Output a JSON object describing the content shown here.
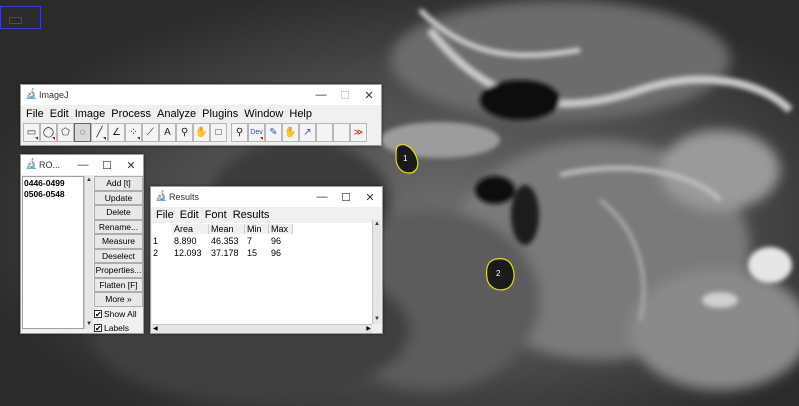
{
  "background": {
    "rois": [
      {
        "label": "1"
      },
      {
        "label": "2"
      }
    ],
    "roi_color": "#e6e000"
  },
  "imagej": {
    "title": "ImageJ",
    "menu": [
      "File",
      "Edit",
      "Image",
      "Process",
      "Analyze",
      "Plugins",
      "Window",
      "Help"
    ],
    "tools": [
      {
        "icon": "rectangle-tool-icon",
        "glyph": "▭"
      },
      {
        "icon": "oval-tool-icon",
        "glyph": "◯"
      },
      {
        "icon": "polygon-tool-icon",
        "glyph": "⬠"
      },
      {
        "icon": "freehand-tool-icon",
        "glyph": "◌"
      },
      {
        "icon": "line-tool-icon",
        "glyph": "╱"
      },
      {
        "icon": "angle-tool-icon",
        "glyph": "∠"
      },
      {
        "icon": "point-tool-icon",
        "glyph": "⁘"
      },
      {
        "icon": "wand-tool-icon",
        "glyph": "⟋"
      },
      {
        "icon": "text-tool-icon",
        "glyph": "A"
      },
      {
        "icon": "magnifying-glass-icon",
        "glyph": "🔍"
      },
      {
        "icon": "scrolling-tool-icon",
        "glyph": "✋"
      },
      {
        "icon": "color-picker-icon",
        "glyph": "□"
      },
      {
        "icon": "zoom-icon",
        "glyph": "Q"
      },
      {
        "icon": "developer-menu-icon",
        "glyph": "Dev"
      },
      {
        "icon": "pencil-tool-icon",
        "glyph": "✎"
      },
      {
        "icon": "hand-tool-icon",
        "glyph": "✋"
      },
      {
        "icon": "arrow-tool-icon",
        "glyph": "↗"
      },
      {
        "icon": "blank-tool-slot",
        "glyph": ""
      },
      {
        "icon": "blank-tool-slot",
        "glyph": ""
      },
      {
        "icon": "more-tools-icon",
        "glyph": "≫"
      }
    ]
  },
  "roi_manager": {
    "title": "RO...",
    "items": [
      "0446-0499",
      "0506-0548"
    ],
    "buttons": [
      "Add [t]",
      "Update",
      "Delete",
      "Rename...",
      "Measure",
      "Deselect",
      "Properties...",
      "Flatten [F]",
      "More »"
    ],
    "show_all_label": "Show All",
    "labels_label": "Labels",
    "show_all_checked": true,
    "labels_checked": true
  },
  "results": {
    "title": "Results",
    "menu": [
      "File",
      "Edit",
      "Font",
      "Results"
    ],
    "columns": [
      "",
      "Area",
      "Mean",
      "Min",
      "Max"
    ],
    "rows": [
      [
        "1",
        "8.890",
        "46.353",
        "7",
        "96"
      ],
      [
        "2",
        "12.093",
        "37.178",
        "15",
        "96"
      ]
    ]
  }
}
